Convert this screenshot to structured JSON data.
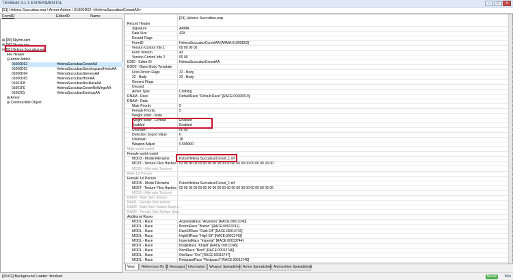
{
  "window": {
    "title": "TES5Edit 3.1.3 EXPERIMENTAL"
  },
  "path": "[01] Helena Succubus.esp \\ Armor Addon \\ 01000D62 <HelenaSuccubusCorsetAA>",
  "left_header": {
    "formid": "FormID",
    "editorid": "EditorID",
    "name": "Name"
  },
  "tree": [
    {
      "t": "[00] Skyrim.esm",
      "icon": "⊞",
      "indent": 0
    },
    {
      "t": "[00] Skyrim.exe",
      "icon": "⊞",
      "indent": 0
    },
    {
      "t": "[01] Helena Succubus.esp",
      "icon": "⊟",
      "indent": 0
    },
    {
      "t": "File Header",
      "icon": "",
      "indent": 1
    },
    {
      "t": "Armor Addon",
      "icon": "⊟",
      "indent": 1
    },
    {
      "t": "01000D62",
      "icon": "",
      "indent": 2,
      "e": "HelenaSuccubusCorsetAA",
      "sel": true
    },
    {
      "t": "01000D63",
      "icon": "",
      "indent": 2,
      "e": "HelenaSuccubusStockingsandHeelsAA"
    },
    {
      "t": "01000D64",
      "icon": "",
      "indent": 2,
      "e": "HelenaSuccubusSleevesAA"
    },
    {
      "t": "01000D65",
      "icon": "",
      "indent": 2,
      "e": "HelenaSuccubusHornAA"
    },
    {
      "t": "01001FB",
      "icon": "",
      "indent": 2,
      "e": "HelenaSuccubusNecklaceAA"
    },
    {
      "t": "01001FE",
      "icon": "",
      "indent": 2,
      "e": "HelenaSuccubusCorsetNoWingsAA"
    },
    {
      "t": "0100201",
      "icon": "",
      "indent": 2,
      "e": "HelenaSuccubusEarringsAA"
    },
    {
      "t": "Armor",
      "icon": "⊞",
      "indent": 1
    },
    {
      "t": "Constructible Object",
      "icon": "⊞",
      "indent": 1
    }
  ],
  "right_header": "[01] Helena Succubus.esp",
  "rows": [
    {
      "l": "Record Header",
      "v": "",
      "k": ""
    },
    {
      "l": "Signature",
      "v": "ARMA",
      "k": "sub"
    },
    {
      "l": "Data Size",
      "v": "429",
      "k": "sub"
    },
    {
      "l": "Record Flags",
      "v": "",
      "k": "sub"
    },
    {
      "l": "FormID",
      "v": "HelenaSuccubusCorsetAA [ARMA:01000D62]",
      "k": "sub"
    },
    {
      "l": "Version Control Info 1",
      "v": "00 00 00 00",
      "k": "sub"
    },
    {
      "l": "Form Version",
      "v": "43",
      "k": "sub"
    },
    {
      "l": "Version Control Info 2",
      "v": "00 00",
      "k": "sub"
    },
    {
      "l": "EDID - Editor ID",
      "v": "HelenaSuccubusCorsetAA",
      "k": ""
    },
    {
      "l": "BOD2 - Biped Body Template",
      "v": "",
      "k": ""
    },
    {
      "l": "First Person Flags",
      "v": "32 - Body",
      "k": "sub"
    },
    {
      "l": "32 - Body",
      "v": "32 - Body",
      "k": "sub"
    },
    {
      "l": "General Flags",
      "v": "",
      "k": "sub"
    },
    {
      "l": "Unused",
      "v": "",
      "k": "sub"
    },
    {
      "l": "Armor Type",
      "v": "Clothing",
      "k": "sub"
    },
    {
      "l": "RNAM - Race",
      "v": "DefaultRace \"Default Race\" [RACE:00000019]",
      "k": ""
    },
    {
      "l": "DNAM - Data",
      "v": "",
      "k": ""
    },
    {
      "l": "Male Priority",
      "v": "5",
      "k": "sub"
    },
    {
      "l": "Female Priority",
      "v": "5",
      "k": "sub"
    },
    {
      "l": "Weight slider - Male",
      "v": "",
      "k": "sub"
    },
    {
      "l": "Weight slider - Female",
      "v": "Enabled",
      "k": "sub"
    },
    {
      "l": "Enabled",
      "v": "Enabled",
      "k": "sub"
    },
    {
      "l": "Unknown",
      "v": "00 00",
      "k": "sub"
    },
    {
      "l": "Detection Sound Value",
      "v": "0",
      "k": "sub"
    },
    {
      "l": "Unknown",
      "v": "18",
      "k": "sub"
    },
    {
      "l": "Weapon Adjust",
      "v": "0.500000",
      "k": "sub"
    },
    {
      "l": "Male world model",
      "v": "",
      "k": "grey"
    },
    {
      "l": "Female world model",
      "v": "",
      "k": ""
    },
    {
      "l": "MOD3 - Model Filename",
      "v": "Putra\\Helena Succubus\\Corset_1.nif",
      "k": "sub"
    },
    {
      "l": "MO3T - Texture Files Hashes",
      "v": "02 00 00 00 00 00 00 00 00 00 00 00 00 00 00 00 00 00 00 00",
      "k": "sub"
    },
    {
      "l": "MO3S - Alternate Textures",
      "v": "",
      "k": "sub grey"
    },
    {
      "l": "Male 1st Person",
      "v": "",
      "k": "grey"
    },
    {
      "l": "Female 1st Person",
      "v": "",
      "k": ""
    },
    {
      "l": "MOD5 - Model Filename",
      "v": "Putra\\Helena Succubus\\Corset_1.nif",
      "k": "sub"
    },
    {
      "l": "MO5T - Texture Files Hashes",
      "v": "02 00 00 00 00 00 00 00 00 00 00 00 00 00 00 00 00 00 00 00",
      "k": "sub"
    },
    {
      "l": "MO5S - Alternate Textures",
      "v": "",
      "k": "sub grey"
    },
    {
      "l": "NAM0 - Male Skin Texture",
      "v": "",
      "k": "grey"
    },
    {
      "l": "NAM1 - Female Skin texture",
      "v": "",
      "k": "grey"
    },
    {
      "l": "NAM2 - Male Skin Texture Swap L...",
      "v": "",
      "k": "grey"
    },
    {
      "l": "NAM3 - Female Skin Texture Swa...",
      "v": "",
      "k": "grey"
    },
    {
      "l": "Additional Races",
      "v": "",
      "k": ""
    },
    {
      "l": "MODL - Race",
      "v": "ArgonianRace \"Argonian\" [RACE:00013740]",
      "k": "sub"
    },
    {
      "l": "MODL - Race",
      "v": "BretonRace \"Breton\" [RACE:00013741]",
      "k": "sub"
    },
    {
      "l": "MODL - Race",
      "v": "DarkElfRace \"Dark Elf\" [RACE:00013742]",
      "k": "sub"
    },
    {
      "l": "MODL - Race",
      "v": "HighElfRace \"High Elf\" [RACE:00013743]",
      "k": "sub"
    },
    {
      "l": "MODL - Race",
      "v": "ImperialRace \"Imperial\" [RACE:00013744]",
      "k": "sub"
    },
    {
      "l": "MODL - Race",
      "v": "KhajiitRace \"Khajiit\" [RACE:00013745]",
      "k": "sub"
    },
    {
      "l": "MODL - Race",
      "v": "NordRace \"Nord\" [RACE:00013746]",
      "k": "sub"
    },
    {
      "l": "MODL - Race",
      "v": "OrcRace \"Orc\" [RACE:00013747]",
      "k": "sub"
    },
    {
      "l": "MODL - Race",
      "v": "RedguardRace \"Redguard\" [RACE:00013748]",
      "k": "sub"
    }
  ],
  "tabs": [
    "View",
    "Referenced By (1)",
    "Messages",
    "Information",
    "Weapon Spreadsheet",
    "Armor Spreadsheet",
    "Ammunition Spreadsheet"
  ],
  "status": "[00:02] Background Loader: finished",
  "badge": "Nexus",
  "badge2": "Wiki",
  "colors": {
    "highlight": "#c8102e",
    "selection": "#cce8ff"
  }
}
